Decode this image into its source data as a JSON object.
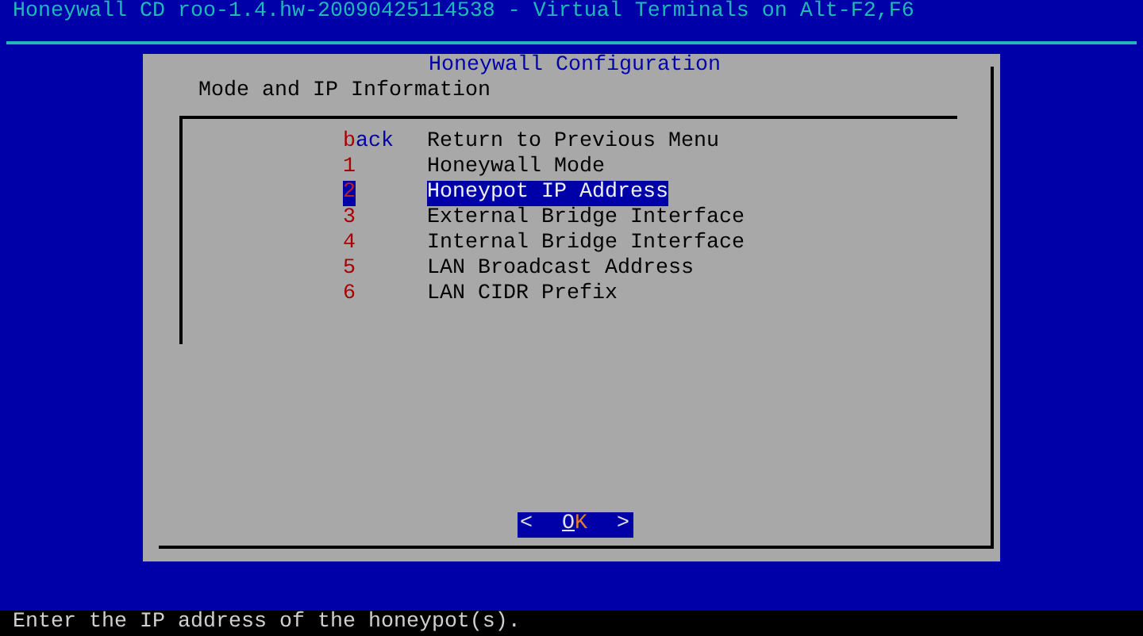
{
  "screen_title": "Honeywall CD roo-1.4.hw-20090425114538 - Virtual Terminals on Alt-F2,F6",
  "dialog": {
    "title": "Honeywall Configuration",
    "subtitle": "Mode and IP Information",
    "menu": [
      {
        "tag": "back",
        "label": "Return to Previous Menu",
        "selected": false
      },
      {
        "tag": "1",
        "label": "Honeywall Mode",
        "selected": false
      },
      {
        "tag": "2",
        "label": "Honeypot IP Address",
        "selected": true
      },
      {
        "tag": "3",
        "label": "External Bridge Interface",
        "selected": false
      },
      {
        "tag": "4",
        "label": "Internal Bridge Interface",
        "selected": false
      },
      {
        "tag": "5",
        "label": "LAN Broadcast Address",
        "selected": false
      },
      {
        "tag": "6",
        "label": "LAN CIDR Prefix",
        "selected": false
      }
    ],
    "button": {
      "left": "<",
      "label": "OK",
      "right": ">",
      "focused": true
    }
  },
  "status_bar": "Enter the IP address of the honeypot(s)."
}
